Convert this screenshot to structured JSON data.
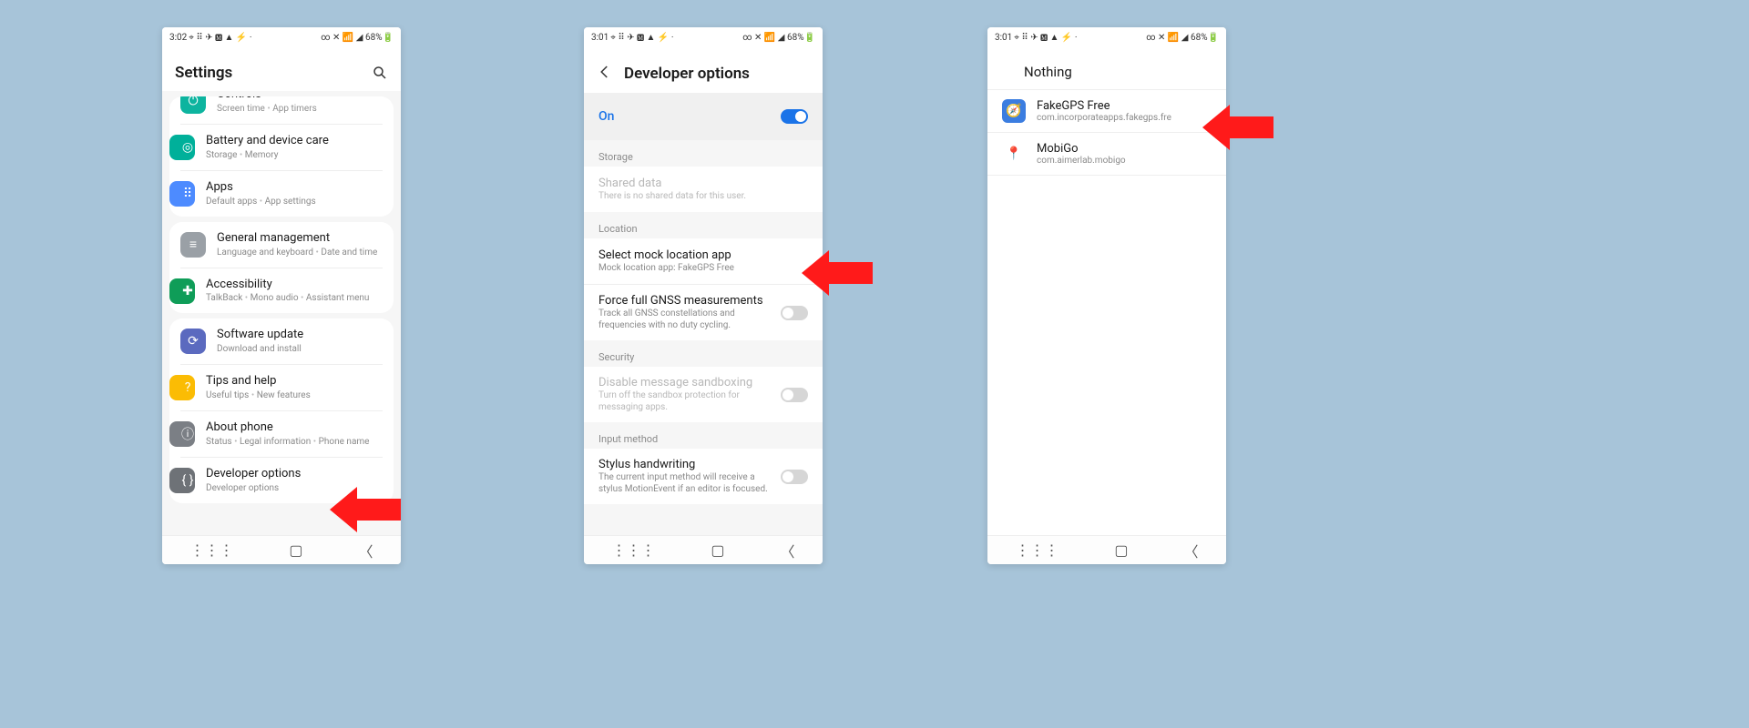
{
  "status": {
    "time1": "3:02",
    "time2": "3:01",
    "time3": "3:01",
    "icons_left": "⌖ ⠿ ✈ 🅼 ▲ ⚡ ·",
    "icons_right": "∞ ✕ 📶 ◢ 68%🔋"
  },
  "screen1": {
    "title": "Settings",
    "items": [
      {
        "name": "controls-item",
        "title": "Controls",
        "sub": [
          "Screen time",
          "App timers"
        ],
        "color": "ic-green",
        "icon": "⏻",
        "clipped": true
      },
      {
        "name": "battery-item",
        "title": "Battery and device care",
        "sub": [
          "Storage",
          "Memory"
        ],
        "color": "ic-green",
        "icon": "◎"
      },
      {
        "name": "apps-item",
        "title": "Apps",
        "sub": [
          "Default apps",
          "App settings"
        ],
        "color": "ic-blue",
        "icon": "⠿"
      },
      {
        "name": "general-item",
        "title": "General management",
        "sub": [
          "Language and keyboard",
          "Date and time"
        ],
        "color": "ic-grey",
        "icon": "≡"
      },
      {
        "name": "accessibility-item",
        "title": "Accessibility",
        "sub": [
          "TalkBack",
          "Mono audio",
          "Assistant menu"
        ],
        "color": "ic-dgreen",
        "icon": "✚"
      },
      {
        "name": "software-item",
        "title": "Software update",
        "sub": [
          "Download and install"
        ],
        "color": "ic-indigo",
        "icon": "⟳"
      },
      {
        "name": "tips-item",
        "title": "Tips and help",
        "sub": [
          "Useful tips",
          "New features"
        ],
        "color": "ic-orange",
        "icon": "?"
      },
      {
        "name": "about-item",
        "title": "About phone",
        "sub": [
          "Status",
          "Legal information",
          "Phone name"
        ],
        "color": "ic-dgrey",
        "icon": "ⓘ"
      },
      {
        "name": "developer-item",
        "title": "Developer options",
        "sub": [
          "Developer options"
        ],
        "color": "ic-dgrey2",
        "icon": "{ }"
      }
    ]
  },
  "screen2": {
    "title": "Developer options",
    "on_label": "On",
    "sections": [
      {
        "label": "Storage",
        "rows": [
          {
            "name": "shared-data-row",
            "title": "Shared data",
            "sub": "There is no shared data for this user.",
            "disabled": true
          }
        ]
      },
      {
        "label": "Location",
        "rows": [
          {
            "name": "mock-location-row",
            "title": "Select mock location app",
            "sub": "Mock location app: FakeGPS Free"
          },
          {
            "name": "gnss-row",
            "title": "Force full GNSS measurements",
            "sub": "Track all GNSS constellations and frequencies with no duty cycling.",
            "toggle": "off"
          }
        ]
      },
      {
        "label": "Security",
        "rows": [
          {
            "name": "sandbox-row",
            "title": "Disable message sandboxing",
            "sub": "Turn off the sandbox protection for messaging apps.",
            "toggle": "off",
            "disabled": true
          }
        ]
      },
      {
        "label": "Input method",
        "rows": [
          {
            "name": "stylus-row",
            "title": "Stylus handwriting",
            "sub": "The current input method will receive a stylus MotionEvent if an editor is focused.",
            "toggle": "off"
          }
        ]
      }
    ]
  },
  "screen3": {
    "nothing": "Nothing",
    "apps": [
      {
        "name": "fakegps-app",
        "title": "FakeGPS Free",
        "pkg": "com.incorporateapps.fakegps.fre",
        "icon_bg": "#3b7de0",
        "icon": "🧭"
      },
      {
        "name": "mobigo-app",
        "title": "MobiGo",
        "pkg": "com.aimerlab.mobigo",
        "icon_bg": "#fff",
        "icon": "📍"
      }
    ]
  }
}
